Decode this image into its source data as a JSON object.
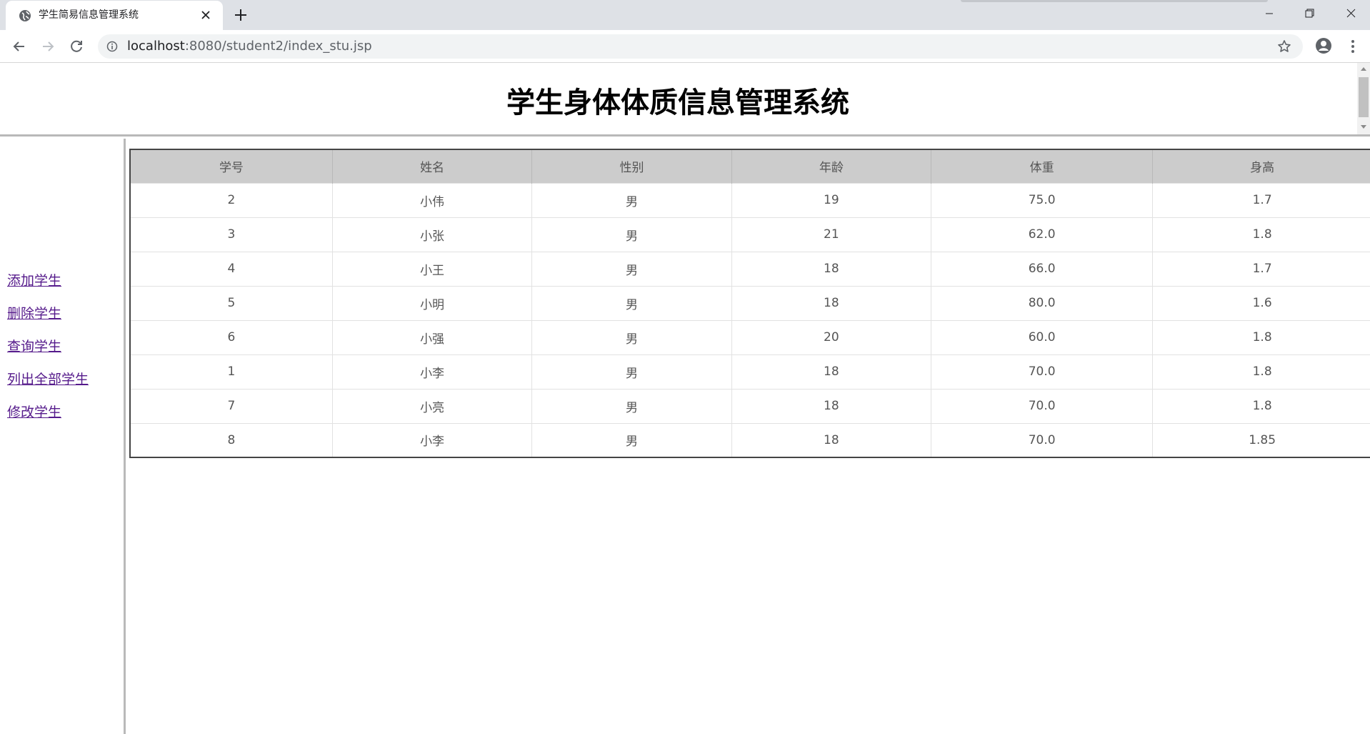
{
  "browser": {
    "tab_title": "学生简易信息管理系统",
    "url_host": "localhost",
    "url_path": ":8080/student2/index_stu.jsp"
  },
  "page": {
    "title": "学生身体体质信息管理系统"
  },
  "menu": {
    "items": [
      "添加学生",
      "删除学生",
      "查询学生",
      "列出全部学生",
      "修改学生"
    ]
  },
  "table": {
    "headers": [
      "学号",
      "姓名",
      "性别",
      "年龄",
      "体重",
      "身高"
    ],
    "rows": [
      [
        "2",
        "小伟",
        "男",
        "19",
        "75.0",
        "1.7"
      ],
      [
        "3",
        "小张",
        "男",
        "21",
        "62.0",
        "1.8"
      ],
      [
        "4",
        "小王",
        "男",
        "18",
        "66.0",
        "1.7"
      ],
      [
        "5",
        "小明",
        "男",
        "18",
        "80.0",
        "1.6"
      ],
      [
        "6",
        "小强",
        "男",
        "20",
        "60.0",
        "1.8"
      ],
      [
        "1",
        "小李",
        "男",
        "18",
        "70.0",
        "1.8"
      ],
      [
        "7",
        "小亮",
        "男",
        "18",
        "70.0",
        "1.8"
      ],
      [
        "8",
        "小李",
        "男",
        "18",
        "70.0",
        "1.85"
      ]
    ]
  }
}
